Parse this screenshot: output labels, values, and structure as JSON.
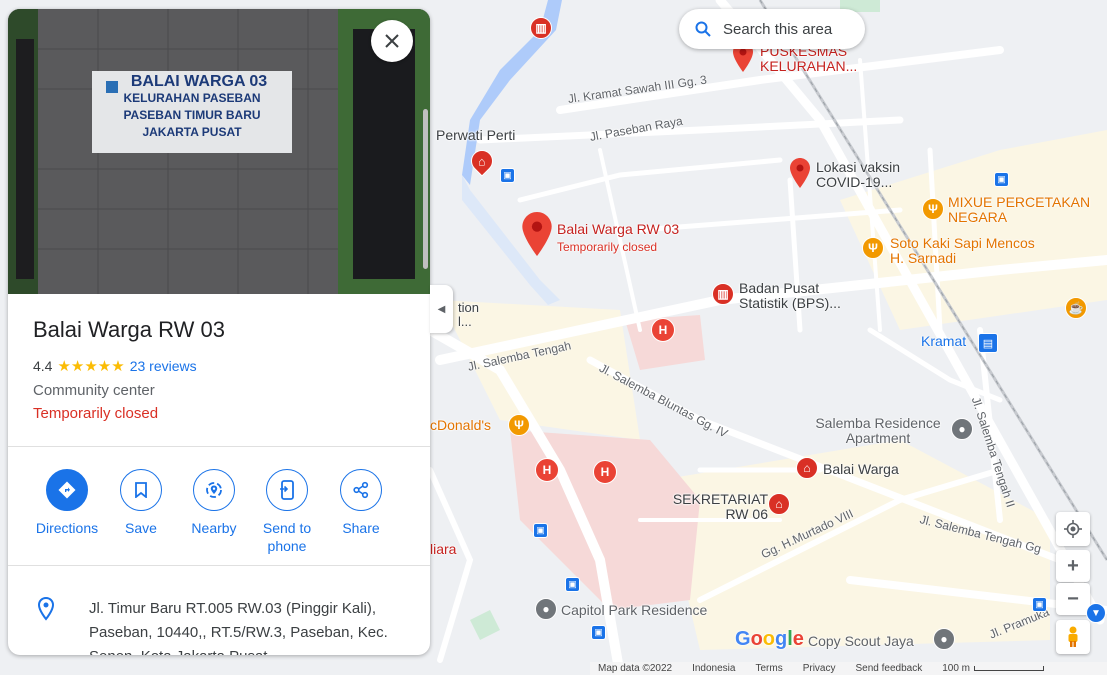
{
  "search_area": {
    "label": "Search this area"
  },
  "place": {
    "name": "Balai Warga RW 03",
    "rating": "4.4",
    "stars": "★★★★★",
    "reviews": "23 reviews",
    "category": "Community center",
    "status": "Temporarily closed",
    "address": "Jl. Timur Baru RT.005 RW.03 (Pinggir Kali), Paseban, 10440,, RT.5/RW.3, Paseban, Kec. Senen, Kota Jakarta Pusat"
  },
  "photo": {
    "sign_line1": "BALAI WARGA 03",
    "sign_line2": "KELURAHAN PASEBAN",
    "sign_line3": "PASEBAN TIMUR BARU",
    "sign_line4": "JAKARTA PUSAT"
  },
  "actions": [
    {
      "label": "Directions",
      "icon": "directions-icon"
    },
    {
      "label": "Save",
      "icon": "bookmark-icon"
    },
    {
      "label": "Nearby",
      "icon": "nearby-icon"
    },
    {
      "label": "Send to phone",
      "icon": "send-to-phone-icon"
    },
    {
      "label": "Share",
      "icon": "share-icon"
    }
  ],
  "map": {
    "streets": {
      "kramat_sawah": "Jl. Kramat Sawah III Gg. 3",
      "paseban_raya": "Jl. Paseban Raya",
      "salemba_tengah": "Jl. Salemba Tengah",
      "salemba_bluntas": "Jl. Salemba Bluntas Gg. IV",
      "salemba_tengah_gg": "Jl. Salemba Tengah Gg",
      "salemba_tengah_ii": "Jl. Salemba Tengah II",
      "murtado": "Gg. H.Murtado VIII",
      "pramuka": "Jl. Pramuka"
    },
    "places": {
      "puskesmas": "PUSKESMAS KELURAHAN...",
      "perwati": "Perwati Perti",
      "vaksin": "Lokasi vaksin COVID-19...",
      "mixue": "MIXUE PERCETAKAN NEGARA",
      "soto": "Soto Kaki Sapi Mencos H. Sarnadi",
      "balai_selected": "Balai Warga RW 03",
      "balai_selected_sub": "Temporarily closed",
      "bps": "Badan Pusat Statistik (BPS)...",
      "kramat": "Kramat",
      "salemba_res": "Salemba Residence Apartment",
      "balai_warga": "Balai Warga",
      "sekretariat": "SEKRETARIAT RW 06",
      "mcdonalds": "cDonald's",
      "capitol": "Capitol Park Residence",
      "copy_scout": "Copy Scout Jaya",
      "tion": "tion",
      "tion2": "l...",
      "iara": "liara"
    },
    "footer": {
      "map_data": "Map data ©2022",
      "country": "Indonesia",
      "terms": "Terms",
      "privacy": "Privacy",
      "feedback": "Send feedback",
      "scale": "100 m"
    },
    "google": "Google"
  },
  "colors": {
    "accent": "#1a73e8",
    "red": "#d93025",
    "star": "#fbbc04",
    "hospital_area": "#f6d9d8",
    "road_yellow": "#fdf3c3"
  }
}
